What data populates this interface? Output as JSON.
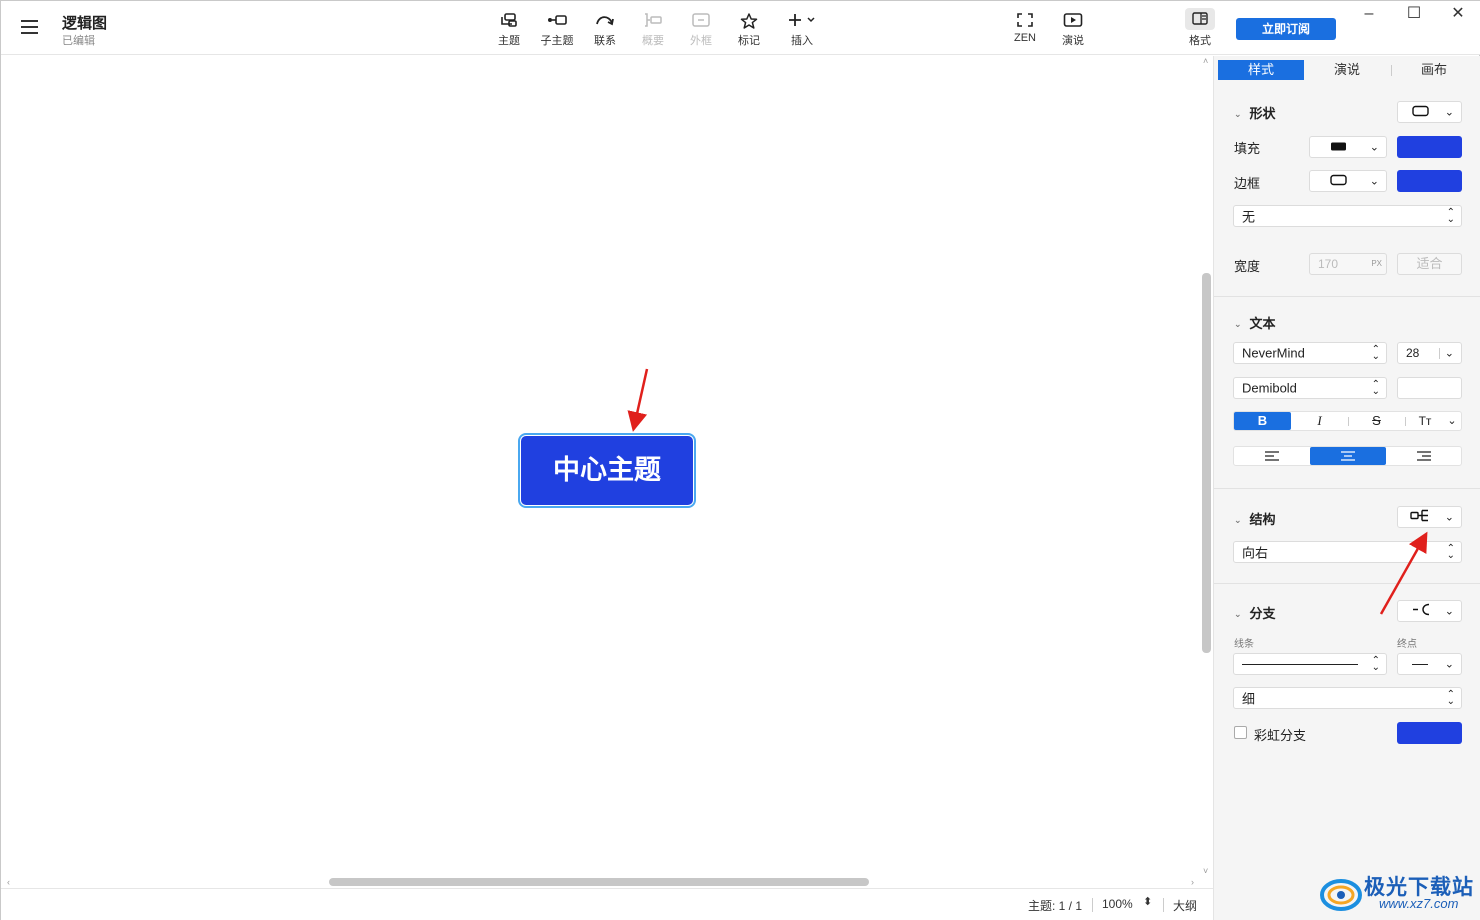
{
  "header": {
    "title": "逻辑图",
    "subtitle": "已编辑",
    "subscribe_label": "立即订阅"
  },
  "toolbar": {
    "items": [
      {
        "label": "主题",
        "icon": "topic-icon",
        "enabled": true
      },
      {
        "label": "子主题",
        "icon": "subtopic-icon",
        "enabled": true
      },
      {
        "label": "联系",
        "icon": "relationship-icon",
        "enabled": true
      },
      {
        "label": "概要",
        "icon": "summary-icon",
        "enabled": false
      },
      {
        "label": "外框",
        "icon": "boundary-icon",
        "enabled": false
      },
      {
        "label": "标记",
        "icon": "star-icon",
        "enabled": true
      },
      {
        "label": "插入",
        "icon": "plus-icon",
        "enabled": true
      },
      {
        "label": "ZEN",
        "icon": "fullscreen-icon",
        "enabled": true
      },
      {
        "label": "演说",
        "icon": "play-icon",
        "enabled": true
      },
      {
        "label": "格式",
        "icon": "panel-toggle-icon",
        "enabled": true
      }
    ]
  },
  "window": {
    "minimize": "–",
    "maximize": "☐",
    "close": "✕"
  },
  "canvas": {
    "central_topic": "中心主题"
  },
  "status": {
    "topic_count": "主题: 1 / 1",
    "zoom": "100%",
    "outline": "大纲"
  },
  "panel": {
    "tabs": [
      {
        "label": "样式",
        "active": true
      },
      {
        "label": "演说",
        "active": false
      },
      {
        "label": "画布",
        "active": false
      }
    ],
    "shape": {
      "title": "形状",
      "fill_label": "填充",
      "border_label": "边框",
      "fill_color": "#2040e0",
      "border_color": "#2040e0",
      "border_style": "无",
      "width_label": "宽度",
      "width_value": "170",
      "width_unit": "PX",
      "fit_label": "适合"
    },
    "text": {
      "title": "文本",
      "font": "NeverMind",
      "size": "28",
      "weight": "Demibold",
      "bold": "B",
      "italic": "I",
      "strike": "S",
      "case": "Tт"
    },
    "structure": {
      "title": "结构",
      "direction": "向右"
    },
    "branch": {
      "title": "分支",
      "line_label": "线条",
      "end_label": "终点",
      "thickness": "细",
      "rainbow_label": "彩虹分支",
      "color": "#2040e0"
    }
  },
  "watermark": {
    "name": "极光下载站",
    "url": "www.xz7.com"
  }
}
